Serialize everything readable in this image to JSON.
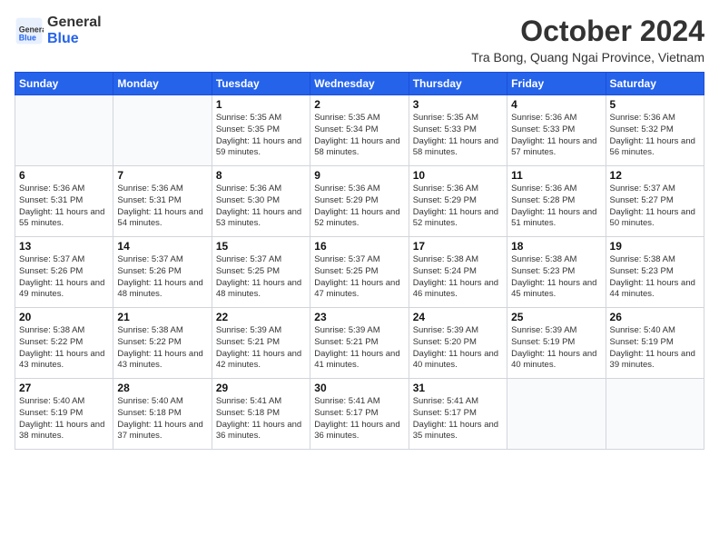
{
  "logo": {
    "line1": "General",
    "line2": "Blue"
  },
  "title": "October 2024",
  "subtitle": "Tra Bong, Quang Ngai Province, Vietnam",
  "weekdays": [
    "Sunday",
    "Monday",
    "Tuesday",
    "Wednesday",
    "Thursday",
    "Friday",
    "Saturday"
  ],
  "weeks": [
    [
      {
        "day": "",
        "info": ""
      },
      {
        "day": "",
        "info": ""
      },
      {
        "day": "1",
        "sunrise": "5:35 AM",
        "sunset": "5:35 PM",
        "daylight": "11 hours and 59 minutes."
      },
      {
        "day": "2",
        "sunrise": "5:35 AM",
        "sunset": "5:34 PM",
        "daylight": "11 hours and 58 minutes."
      },
      {
        "day": "3",
        "sunrise": "5:35 AM",
        "sunset": "5:33 PM",
        "daylight": "11 hours and 58 minutes."
      },
      {
        "day": "4",
        "sunrise": "5:36 AM",
        "sunset": "5:33 PM",
        "daylight": "11 hours and 57 minutes."
      },
      {
        "day": "5",
        "sunrise": "5:36 AM",
        "sunset": "5:32 PM",
        "daylight": "11 hours and 56 minutes."
      }
    ],
    [
      {
        "day": "6",
        "sunrise": "5:36 AM",
        "sunset": "5:31 PM",
        "daylight": "11 hours and 55 minutes."
      },
      {
        "day": "7",
        "sunrise": "5:36 AM",
        "sunset": "5:31 PM",
        "daylight": "11 hours and 54 minutes."
      },
      {
        "day": "8",
        "sunrise": "5:36 AM",
        "sunset": "5:30 PM",
        "daylight": "11 hours and 53 minutes."
      },
      {
        "day": "9",
        "sunrise": "5:36 AM",
        "sunset": "5:29 PM",
        "daylight": "11 hours and 52 minutes."
      },
      {
        "day": "10",
        "sunrise": "5:36 AM",
        "sunset": "5:29 PM",
        "daylight": "11 hours and 52 minutes."
      },
      {
        "day": "11",
        "sunrise": "5:36 AM",
        "sunset": "5:28 PM",
        "daylight": "11 hours and 51 minutes."
      },
      {
        "day": "12",
        "sunrise": "5:37 AM",
        "sunset": "5:27 PM",
        "daylight": "11 hours and 50 minutes."
      }
    ],
    [
      {
        "day": "13",
        "sunrise": "5:37 AM",
        "sunset": "5:26 PM",
        "daylight": "11 hours and 49 minutes."
      },
      {
        "day": "14",
        "sunrise": "5:37 AM",
        "sunset": "5:26 PM",
        "daylight": "11 hours and 48 minutes."
      },
      {
        "day": "15",
        "sunrise": "5:37 AM",
        "sunset": "5:25 PM",
        "daylight": "11 hours and 48 minutes."
      },
      {
        "day": "16",
        "sunrise": "5:37 AM",
        "sunset": "5:25 PM",
        "daylight": "11 hours and 47 minutes."
      },
      {
        "day": "17",
        "sunrise": "5:38 AM",
        "sunset": "5:24 PM",
        "daylight": "11 hours and 46 minutes."
      },
      {
        "day": "18",
        "sunrise": "5:38 AM",
        "sunset": "5:23 PM",
        "daylight": "11 hours and 45 minutes."
      },
      {
        "day": "19",
        "sunrise": "5:38 AM",
        "sunset": "5:23 PM",
        "daylight": "11 hours and 44 minutes."
      }
    ],
    [
      {
        "day": "20",
        "sunrise": "5:38 AM",
        "sunset": "5:22 PM",
        "daylight": "11 hours and 43 minutes."
      },
      {
        "day": "21",
        "sunrise": "5:38 AM",
        "sunset": "5:22 PM",
        "daylight": "11 hours and 43 minutes."
      },
      {
        "day": "22",
        "sunrise": "5:39 AM",
        "sunset": "5:21 PM",
        "daylight": "11 hours and 42 minutes."
      },
      {
        "day": "23",
        "sunrise": "5:39 AM",
        "sunset": "5:21 PM",
        "daylight": "11 hours and 41 minutes."
      },
      {
        "day": "24",
        "sunrise": "5:39 AM",
        "sunset": "5:20 PM",
        "daylight": "11 hours and 40 minutes."
      },
      {
        "day": "25",
        "sunrise": "5:39 AM",
        "sunset": "5:19 PM",
        "daylight": "11 hours and 40 minutes."
      },
      {
        "day": "26",
        "sunrise": "5:40 AM",
        "sunset": "5:19 PM",
        "daylight": "11 hours and 39 minutes."
      }
    ],
    [
      {
        "day": "27",
        "sunrise": "5:40 AM",
        "sunset": "5:19 PM",
        "daylight": "11 hours and 38 minutes."
      },
      {
        "day": "28",
        "sunrise": "5:40 AM",
        "sunset": "5:18 PM",
        "daylight": "11 hours and 37 minutes."
      },
      {
        "day": "29",
        "sunrise": "5:41 AM",
        "sunset": "5:18 PM",
        "daylight": "11 hours and 36 minutes."
      },
      {
        "day": "30",
        "sunrise": "5:41 AM",
        "sunset": "5:17 PM",
        "daylight": "11 hours and 36 minutes."
      },
      {
        "day": "31",
        "sunrise": "5:41 AM",
        "sunset": "5:17 PM",
        "daylight": "11 hours and 35 minutes."
      },
      {
        "day": "",
        "info": ""
      },
      {
        "day": "",
        "info": ""
      }
    ]
  ]
}
